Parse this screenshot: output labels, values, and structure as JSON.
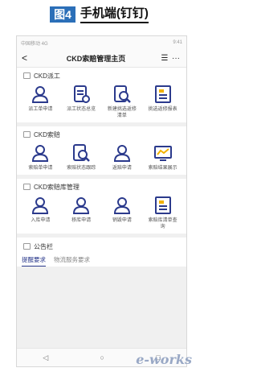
{
  "caption": {
    "tag": "图4",
    "title": "手机端(钉钉)"
  },
  "statusbar": {
    "left": "中国移动 4G",
    "right": "9:41"
  },
  "navbar": {
    "back": "<",
    "title": "CKD索赔管理主页",
    "menu": "☰",
    "more": "···"
  },
  "sections": [
    {
      "title": "CKD派工",
      "items": [
        {
          "label": "派工单申请",
          "icon": "user-icon"
        },
        {
          "label": "派工状态总览",
          "icon": "document-icon"
        },
        {
          "label": "新建挑选返修清单",
          "icon": "search-document-icon"
        },
        {
          "label": "挑选返修报表",
          "icon": "report-icon"
        }
      ]
    },
    {
      "title": "CKD索赔",
      "items": [
        {
          "label": "索赔单申请",
          "icon": "user-icon"
        },
        {
          "label": "索赔状态跟踪",
          "icon": "search-document-icon"
        },
        {
          "label": "返赔申请",
          "icon": "user-icon"
        },
        {
          "label": "索赔结果展示",
          "icon": "chart-icon"
        }
      ]
    },
    {
      "title": "CKD索赔库管理",
      "items": [
        {
          "label": "入库申请",
          "icon": "user-icon"
        },
        {
          "label": "移库申请",
          "icon": "user-icon"
        },
        {
          "label": "销毁申请",
          "icon": "user-icon"
        },
        {
          "label": "索赔库清单查询",
          "icon": "report-icon"
        }
      ]
    }
  ],
  "notice": {
    "title": "公告栏",
    "tab_active": "提醒要求",
    "tab_other": "物流服务要求"
  },
  "bottom": {
    "back": "◁",
    "home": "○",
    "recent": "□"
  },
  "watermark": "e-works"
}
